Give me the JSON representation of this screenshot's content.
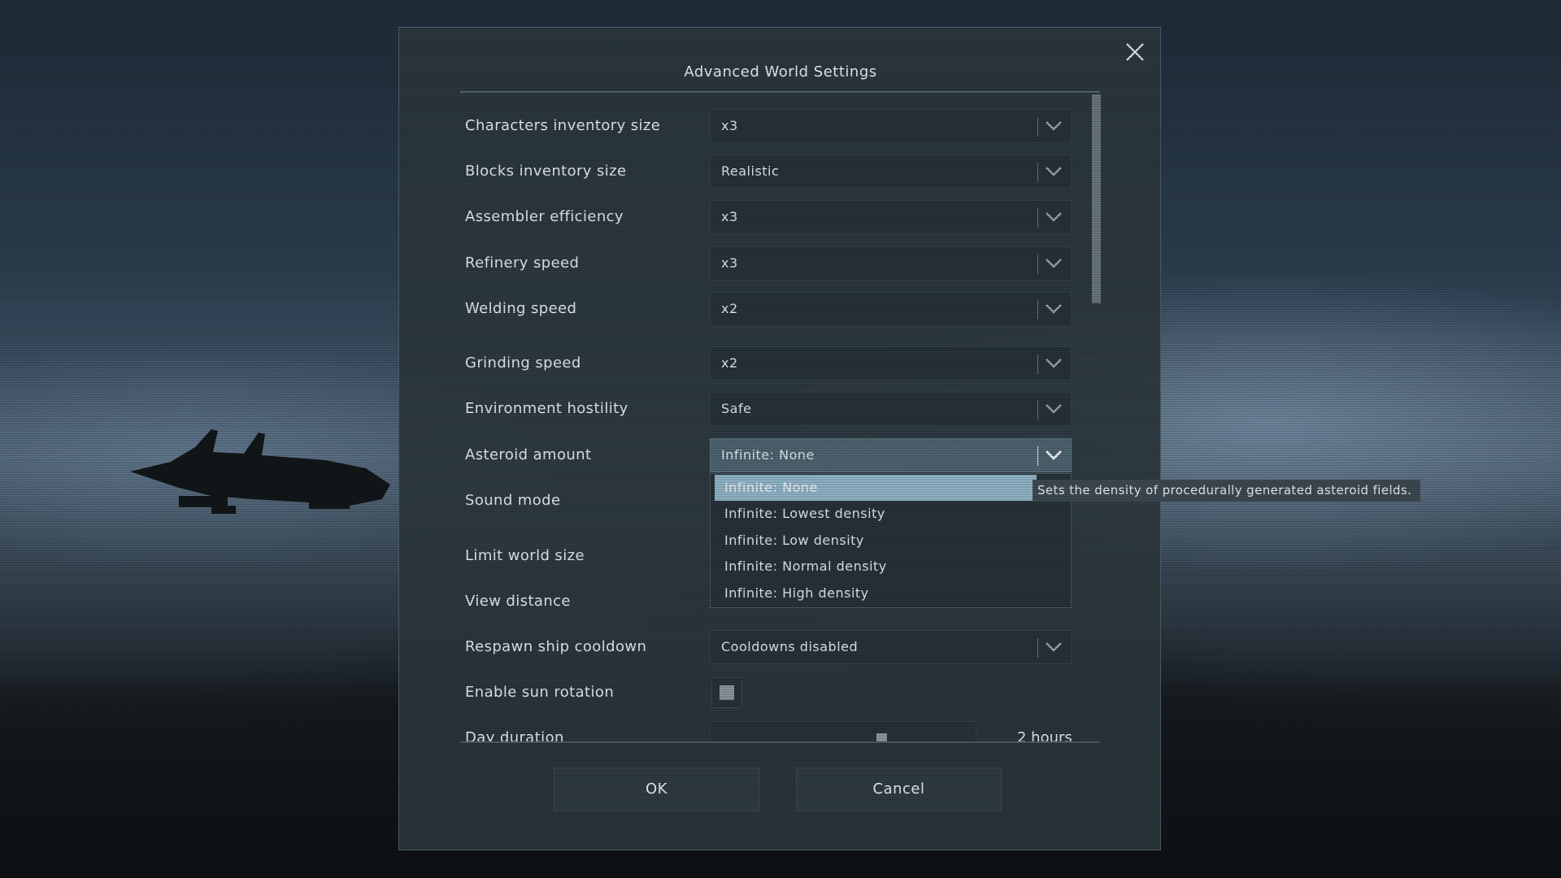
{
  "dialog": {
    "title": "Advanced World Settings",
    "ok_label": "OK",
    "cancel_label": "Cancel"
  },
  "settings": [
    {
      "label": "Characters inventory size",
      "value": "x3"
    },
    {
      "label": "Blocks inventory size",
      "value": "Realistic"
    },
    {
      "label": "Assembler efficiency",
      "value": "x3"
    },
    {
      "label": "Refinery speed",
      "value": "x3"
    },
    {
      "label": "Welding speed",
      "value": "x2"
    },
    {
      "label": "Grinding speed",
      "value": "x2"
    },
    {
      "label": "Environment hostility",
      "value": "Safe"
    },
    {
      "label": "Asteroid amount",
      "value": "Infinite: None"
    },
    {
      "label": "Sound mode",
      "value": ""
    },
    {
      "label": "Limit world size",
      "value": ""
    },
    {
      "label": "View distance",
      "value": ""
    },
    {
      "label": "Respawn ship cooldown",
      "value": "Cooldowns disabled"
    },
    {
      "label": "Enable sun rotation",
      "checked": false
    },
    {
      "label": "Day duration",
      "value": "2 hours"
    }
  ],
  "asteroid_dropdown": {
    "options": [
      "Infinite: None",
      "Infinite: Lowest density",
      "Infinite: Low density",
      "Infinite: Normal density",
      "Infinite: High density"
    ],
    "selected": "Infinite: None"
  },
  "tooltip": "Sets the density of procedurally generated asteroid fields.",
  "day_duration_slider_fraction": 0.66,
  "icons": {
    "close": "close-icon",
    "chevron": "chevron-down-icon"
  },
  "colors": {
    "dialog_bg": "#2d3940",
    "highlight": "#93b7cb",
    "field_bg": "#27333a"
  }
}
